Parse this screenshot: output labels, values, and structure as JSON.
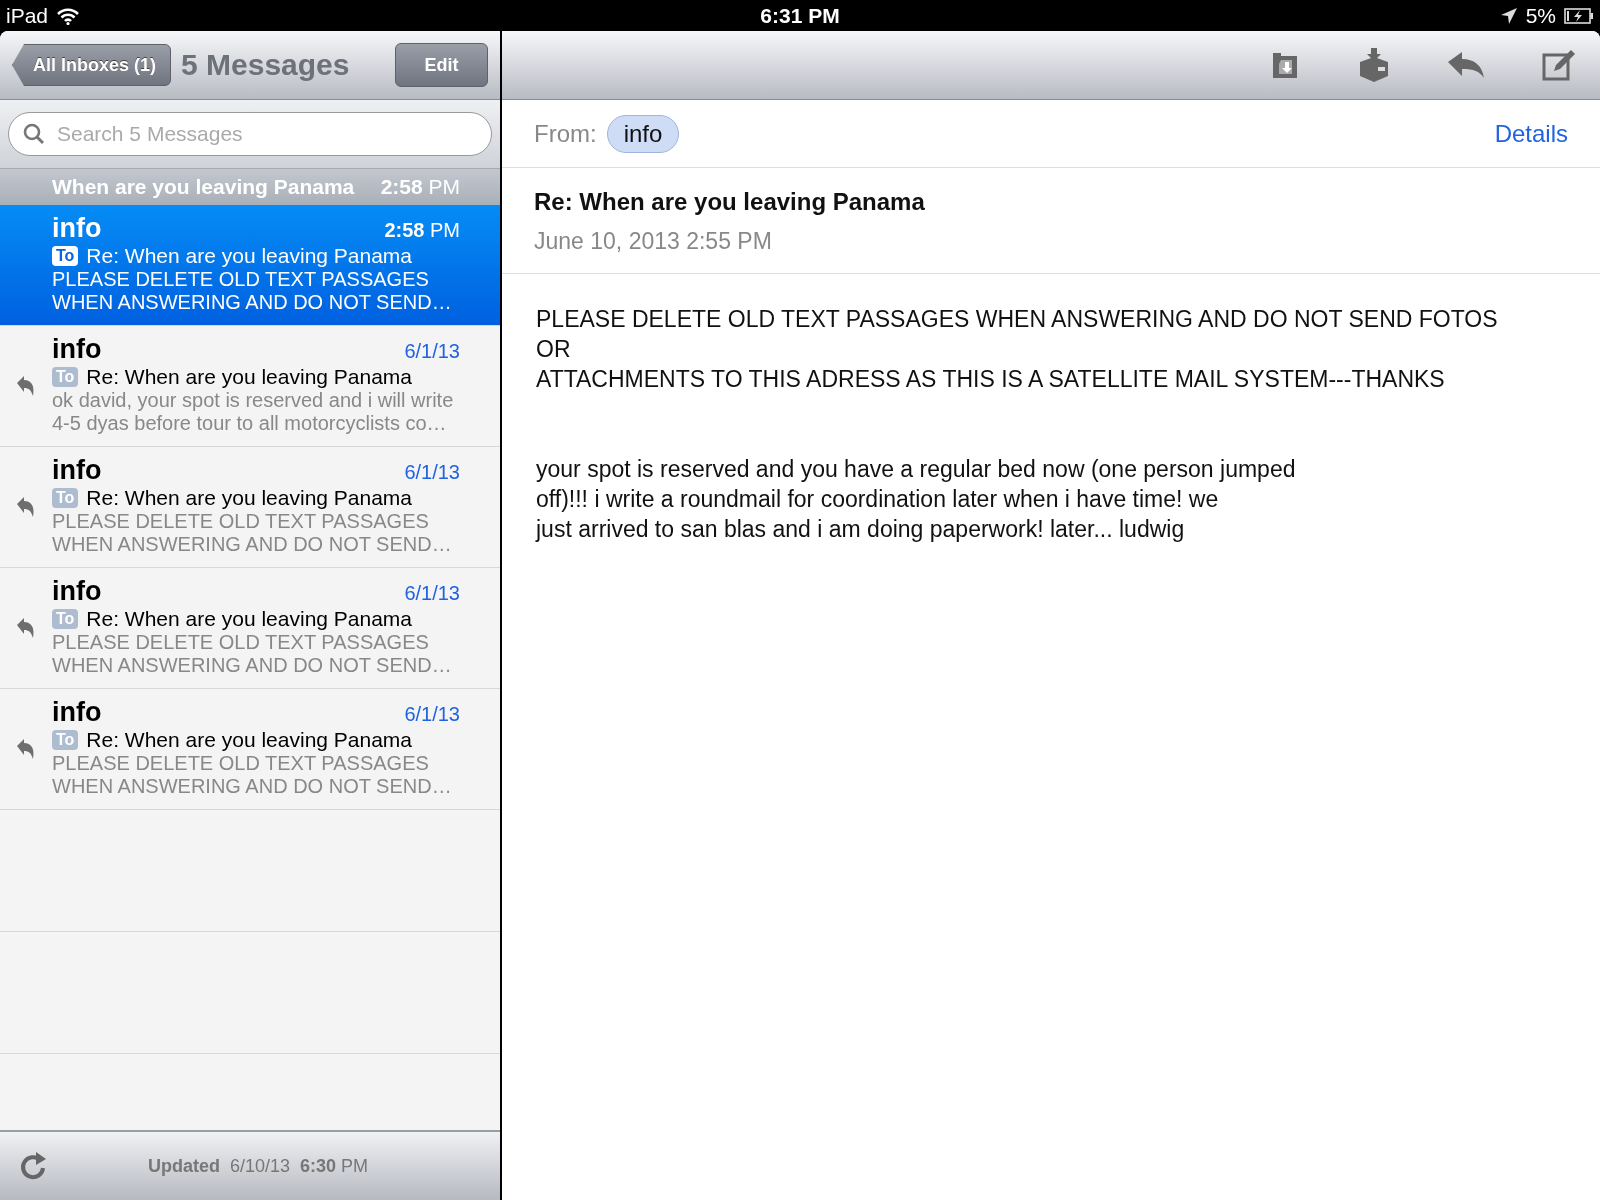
{
  "status_bar": {
    "device": "iPad",
    "time": "6:31 PM",
    "battery": "5%"
  },
  "list_nav": {
    "back": "All Inboxes (1)",
    "title": "5 Messages",
    "edit": "Edit"
  },
  "search": {
    "placeholder": "Search 5 Messages"
  },
  "thread_header": {
    "subject": "When are you leaving Panama",
    "time": "**2:58** PM"
  },
  "messages": [
    {
      "sender": "info",
      "date": "**2:58** PM",
      "subject": "Re: When are you leaving Panama",
      "to_badge": "To",
      "preview": "PLEASE DELETE OLD TEXT PASSAGES\nWHEN ANSWERING AND DO NOT SEND…",
      "replied": false,
      "selected": true
    },
    {
      "sender": "info",
      "date": "6/1/13",
      "subject": "Re: When are you leaving Panama",
      "to_badge": "To",
      "preview": "ok david, your spot is reserved and i will write\n4-5 dyas before tour to all motorcyclists co…",
      "replied": true,
      "selected": false
    },
    {
      "sender": "info",
      "date": "6/1/13",
      "subject": "Re: When are you leaving Panama",
      "to_badge": "To",
      "preview": "PLEASE DELETE OLD TEXT PASSAGES\nWHEN ANSWERING AND DO NOT SEND…",
      "replied": true,
      "selected": false
    },
    {
      "sender": "info",
      "date": "6/1/13",
      "subject": "Re: When are you leaving Panama",
      "to_badge": "To",
      "preview": "PLEASE DELETE OLD TEXT PASSAGES\nWHEN ANSWERING AND DO NOT SEND…",
      "replied": true,
      "selected": false
    },
    {
      "sender": "info",
      "date": "6/1/13",
      "subject": "Re: When are you leaving Panama",
      "to_badge": "To",
      "preview": "PLEASE DELETE OLD TEXT PASSAGES\nWHEN ANSWERING AND DO NOT SEND…",
      "replied": true,
      "selected": false
    }
  ],
  "footer": {
    "updated": "**Updated**  6/10/13  **6:30** PM"
  },
  "message": {
    "from_label": "From:",
    "from": "info",
    "details": "Details",
    "subject": "Re: When are you leaving Panama",
    "date": "June 10, 2013 2:55 PM",
    "paragraphs": [
      "PLEASE DELETE OLD TEXT PASSAGES WHEN ANSWERING AND DO NOT SEND FOTOS\nOR\nATTACHMENTS TO THIS ADRESS AS THIS IS A SATELLITE MAIL SYSTEM---THANKS",
      "your spot is reserved and you have a regular bed now (one person jumped\noff)!!! i write a roundmail for coordination later when i have time! we\njust arrived to san blas and i am doing paperwork! later... ludwig"
    ]
  }
}
